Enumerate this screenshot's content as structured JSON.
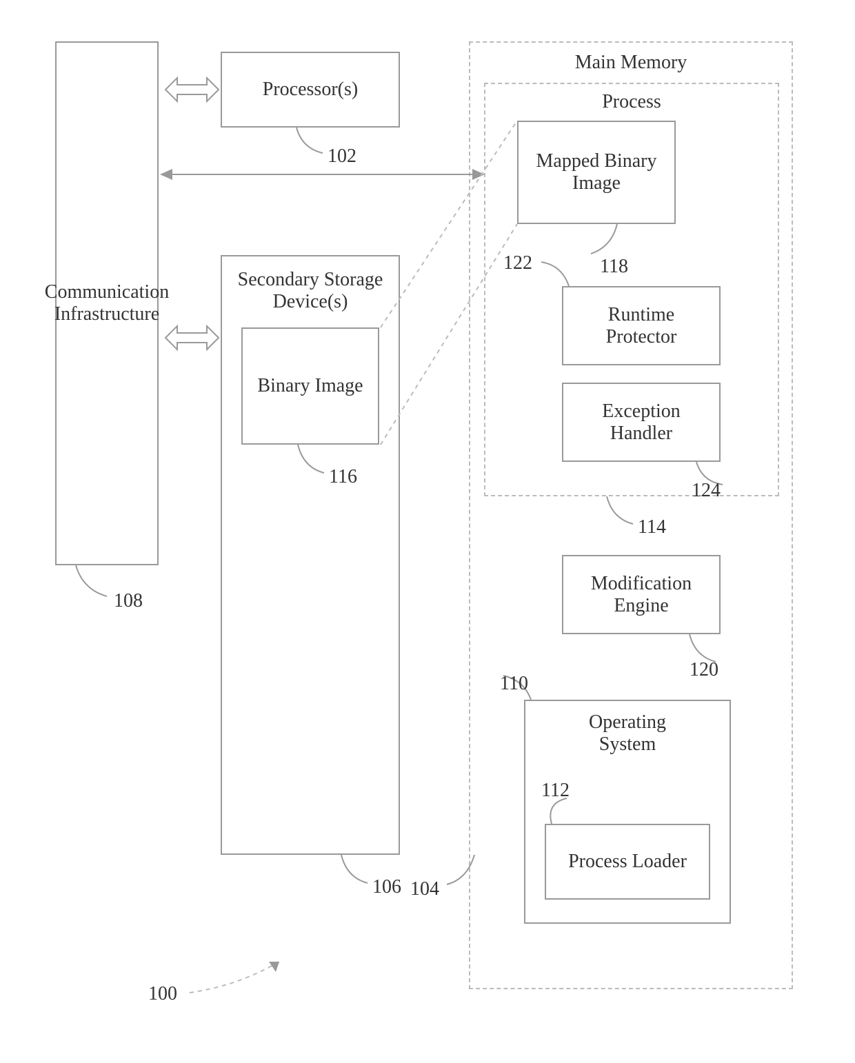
{
  "comm_infra": {
    "label": "Communication\nInfrastructure",
    "ref": "108"
  },
  "processor": {
    "label": "Processor(s)",
    "ref": "102"
  },
  "secondary_storage": {
    "label": "Secondary Storage\nDevice(s)",
    "ref": "106"
  },
  "binary_image": {
    "label": "Binary Image",
    "ref": "116"
  },
  "main_memory": {
    "label": "Main Memory",
    "ref": "104"
  },
  "process": {
    "label": "Process",
    "ref": "114"
  },
  "mapped_binary": {
    "label": "Mapped Binary\nImage",
    "ref": "118"
  },
  "runtime_protector": {
    "label": "Runtime\nProtector",
    "ref": "122"
  },
  "exception_handler": {
    "label": "Exception\nHandler",
    "ref": "124"
  },
  "modification_engine": {
    "label": "Modification\nEngine",
    "ref": "120"
  },
  "operating_system": {
    "label": "Operating\nSystem",
    "ref": "110"
  },
  "process_loader": {
    "label": "Process Loader",
    "ref": "112"
  },
  "figure_ref": "100"
}
